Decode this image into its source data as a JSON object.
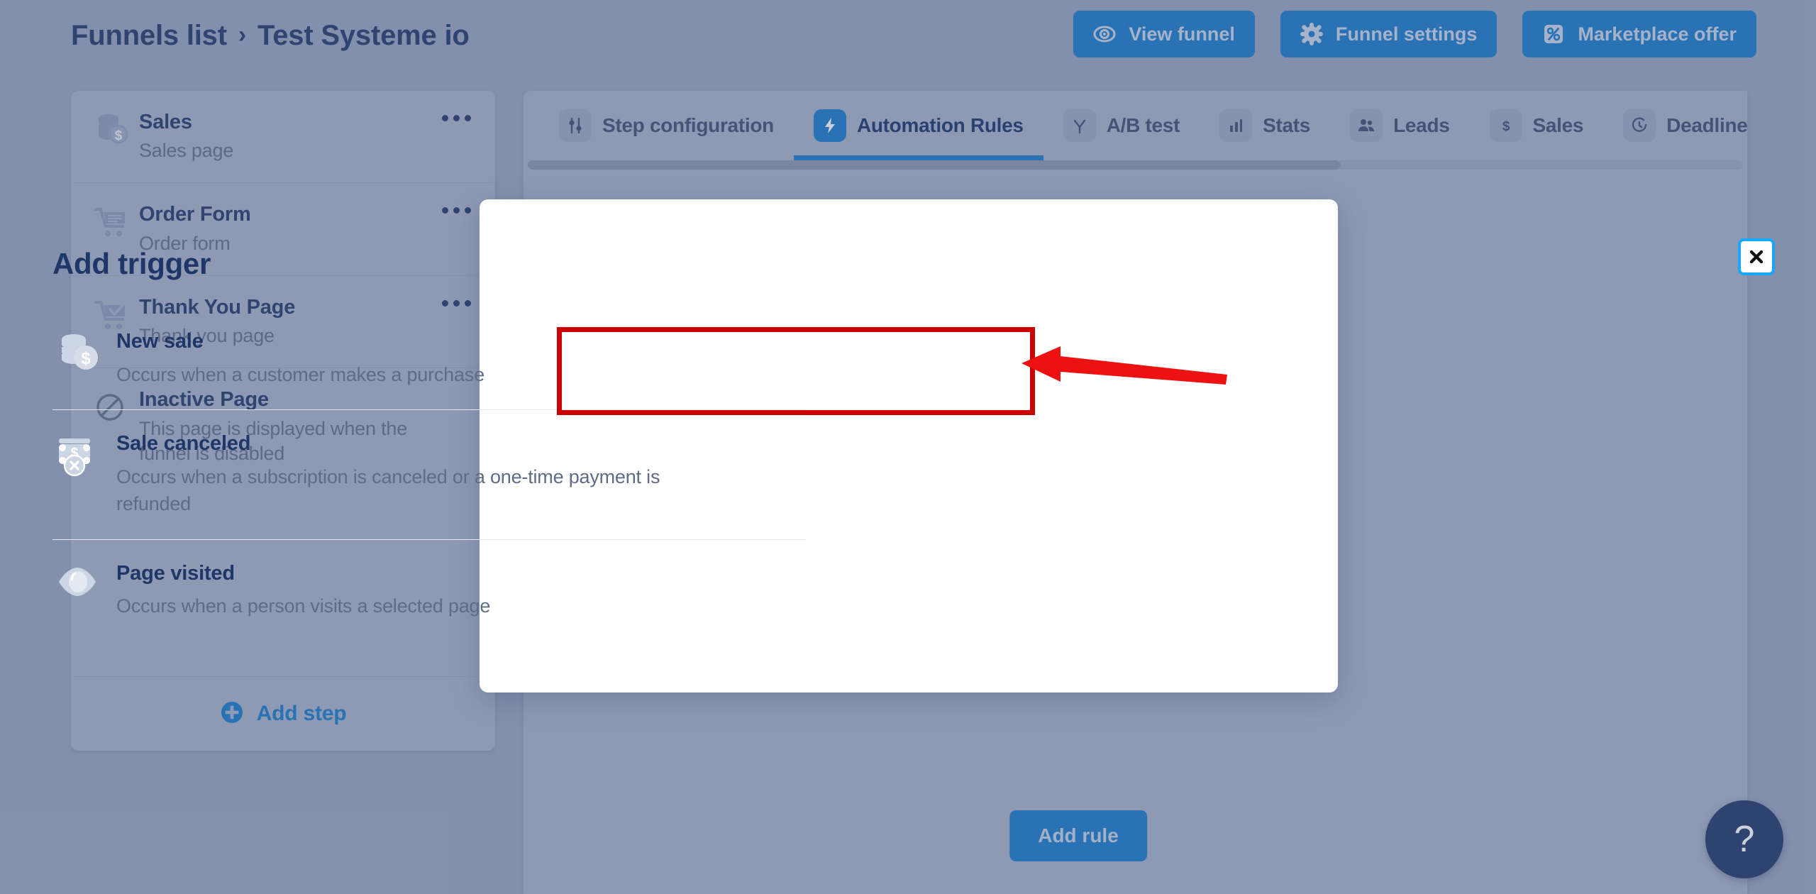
{
  "header": {
    "breadcrumb_root": "Funnels list",
    "breadcrumb_separator": "›",
    "breadcrumb_current": "Test Systeme io",
    "actions": [
      {
        "label": "View funnel",
        "icon": "eye-icon"
      },
      {
        "label": "Funnel settings",
        "icon": "gear-icon"
      },
      {
        "label": "Marketplace offer",
        "icon": "percent-tag-icon"
      }
    ]
  },
  "sidebar": {
    "steps": [
      {
        "title": "Sales",
        "subtitle": "Sales page",
        "icon": "coins-dollar-icon",
        "has_menu": true
      },
      {
        "title": "Order Form",
        "subtitle": "Order form",
        "icon": "cart-icon",
        "has_menu": true
      },
      {
        "title": "Thank You Page",
        "subtitle": "Thank you page",
        "icon": "cart-check-icon",
        "has_menu": true
      },
      {
        "title": "Inactive Page",
        "subtitle": "This page is displayed when the funnel is disabled",
        "icon": "prohibited-icon",
        "has_menu": false
      }
    ],
    "add_step_label": "Add step",
    "add_step_icon": "plus-circle-icon"
  },
  "tabs": [
    {
      "label": "Step configuration",
      "icon": "sliders-icon",
      "active": false
    },
    {
      "label": "Automation Rules",
      "icon": "bolt-icon",
      "active": true
    },
    {
      "label": "A/B test",
      "icon": "split-icon",
      "active": false
    },
    {
      "label": "Stats",
      "icon": "bar-chart-icon",
      "active": false
    },
    {
      "label": "Leads",
      "icon": "people-icon",
      "active": false
    },
    {
      "label": "Sales",
      "icon": "dollar-icon",
      "active": false
    },
    {
      "label": "Deadline s",
      "icon": "clock-icon",
      "active": false
    }
  ],
  "content": {
    "add_rule_label": "Add rule"
  },
  "modal": {
    "title": "Add trigger",
    "close_icon": "close-icon",
    "triggers": [
      {
        "title": "New sale",
        "description": "Occurs when a customer makes a purchase",
        "icon": "coins-dollar-icon",
        "highlighted": true
      },
      {
        "title": "Sale canceled",
        "description": "Occurs when a subscription is canceled or a one-time payment is refunded",
        "icon": "money-cancel-icon",
        "highlighted": false
      },
      {
        "title": "Page visited",
        "description": "Occurs when a person visits a selected page",
        "icon": "eye-icon",
        "highlighted": false
      }
    ]
  },
  "help": {
    "label": "?"
  },
  "colors": {
    "accent_blue": "#1578c8",
    "navy": "#1e3668",
    "page_bg": "#96a2bd",
    "panel_bg": "#a5afc8",
    "annotation_red": "#cc0000",
    "focus_ring": "#18a7f7"
  }
}
